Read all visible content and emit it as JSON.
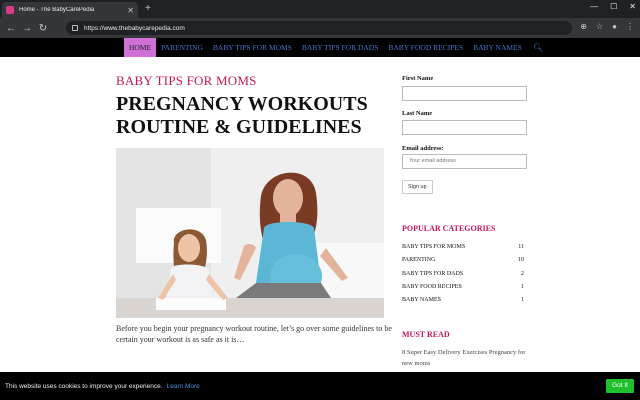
{
  "browser": {
    "tab_title": "Home - The BabyCarePedia",
    "url": "https://www.thebabycarepedia.com"
  },
  "nav": {
    "items": [
      "Home",
      "Parenting",
      "Baby Tips for Moms",
      "Baby Tips for Dads",
      "Baby Food Recipes",
      "Baby Names"
    ]
  },
  "article": {
    "category": "BABY TIPS FOR MOMS",
    "title": "PREGNANCY WORKOUTS ROUTINE & GUIDELINES",
    "excerpt": "Before you begin your pregnancy workout routine, let’s go over some guidelines to be certain your workout is as safe as it is…"
  },
  "sidebar": {
    "first_name_label": "First Name",
    "last_name_label": "Last Name",
    "email_label": "Email address:",
    "email_placeholder": "Your email address",
    "signup_label": "Sign up",
    "popular_heading": "POPULAR CATEGORIES",
    "categories": [
      {
        "name": "Baby Tips for Moms",
        "count": "11"
      },
      {
        "name": "Parenting",
        "count": "10"
      },
      {
        "name": "Baby Tips for Dads",
        "count": "2"
      },
      {
        "name": "Baby Food Recipes",
        "count": "1"
      },
      {
        "name": "Baby Names",
        "count": "1"
      }
    ],
    "mustread_heading": "MUST READ",
    "mustread_item": "8 Super Easy Delivery Exercises Pregnancy for new moms"
  },
  "cookie": {
    "text": "This website uses cookies to improve your experience.",
    "learn_more": "Learn More",
    "button": "Got It"
  },
  "colors": {
    "accent": "#c2185b",
    "nav_link": "#4a74c9",
    "nav_active": "#d06fd6",
    "cookie_button": "#1fbf2e"
  }
}
